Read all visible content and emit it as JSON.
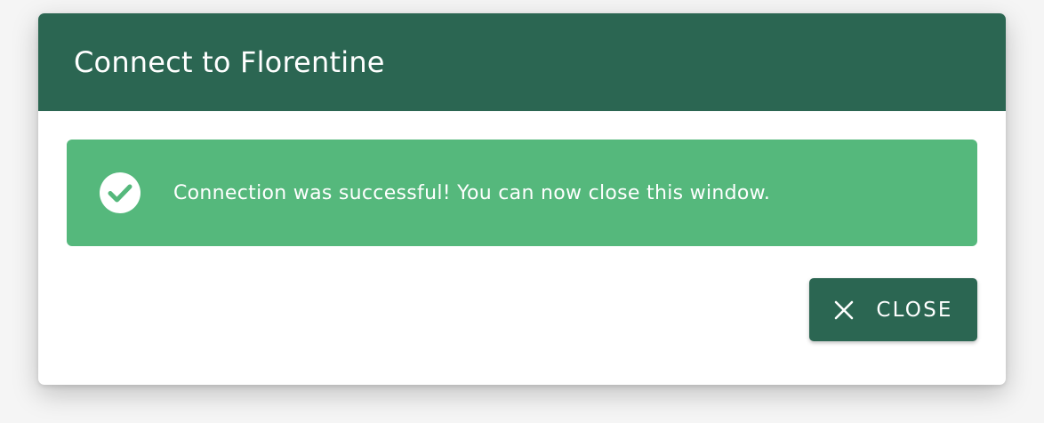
{
  "dialog": {
    "title": "Connect to Florentine"
  },
  "alert": {
    "icon": "check-circle-icon",
    "message": "Connection was successful! You can now close this window.",
    "color": "#55b87c"
  },
  "actions": {
    "close_icon": "close-icon",
    "close_label": "CLOSE"
  },
  "colors": {
    "primary": "#2b6652",
    "success": "#55b87c"
  }
}
